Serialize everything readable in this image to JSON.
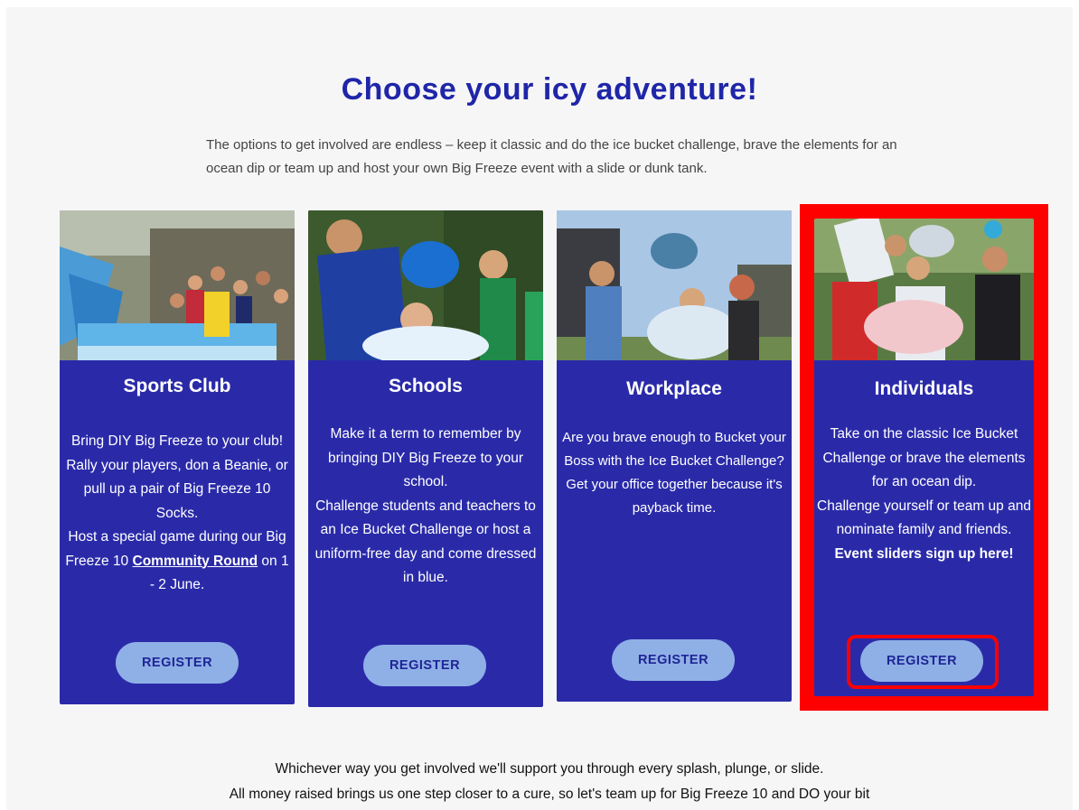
{
  "heading": "Choose your icy adventure!",
  "intro": "The options to get involved are endless – keep it classic and do the ice bucket challenge, brave the elements for an ocean dip or team up and host your own Big Freeze event with a slide or dunk tank.",
  "cards": [
    {
      "title": "Sports Club",
      "lines": [
        "Bring DIY Big Freeze to your club! Rally your players, don a Beanie, or pull up a pair of Big Freeze 10 Socks.",
        "Host a special game during our Big Freeze 10 "
      ],
      "link": "Community Round",
      "after_link": " on 1 - 2 June.",
      "register": "REGISTER"
    },
    {
      "title": "Schools",
      "lines": [
        "Make it a term to remember by bringing DIY Big Freeze to your school.",
        "Challenge students and teachers to an Ice Bucket Challenge or host a uniform-free day and come dressed in blue."
      ],
      "register": "REGISTER"
    },
    {
      "title": "Workplace",
      "lines": [
        "Are you brave enough to Bucket your Boss with the Ice Bucket Challenge?",
        "Get your office together because it's payback time."
      ],
      "register": "REGISTER"
    },
    {
      "title": "Individuals",
      "lines": [
        "Take on the classic Ice Bucket Challenge or brave the elements for an ocean dip.",
        "Challenge yourself or team up and nominate family and friends."
      ],
      "bold_line": "Event sliders sign up here!",
      "register": "REGISTER"
    }
  ],
  "footer": [
    "Whichever way you get involved we'll support you through every splash, plunge, or slide.",
    "All money raised brings us one step closer to a cure, so let's team up for Big Freeze 10 and DO your bit"
  ],
  "colors": {
    "heading": "#1f26a8",
    "card_bg": "#2a2aa9",
    "button_bg": "#8fb0e6",
    "button_text": "#1f2596",
    "highlight": "#ff0000"
  }
}
